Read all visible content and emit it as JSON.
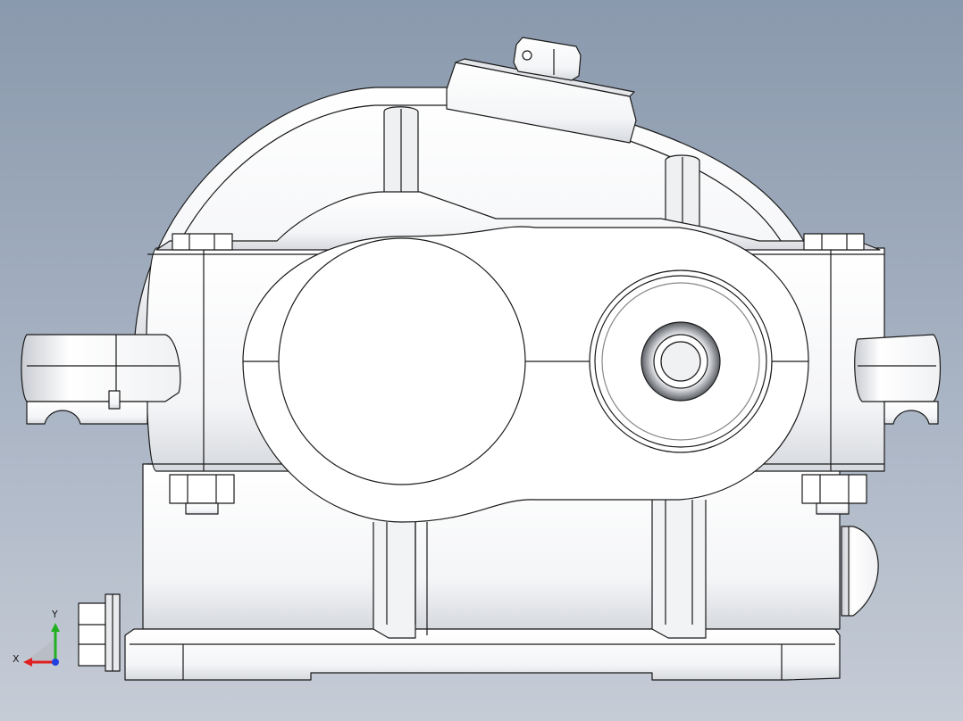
{
  "viewport": {
    "background_top": "#8a99ad",
    "background_bottom": "#c6ccd6"
  },
  "model": {
    "name": "gear-reducer-housing",
    "view": "front",
    "edge_color": "#1a1a1a",
    "face_color": "#ffffff",
    "shade_color": "#d8dbe0"
  },
  "triad": {
    "x_label": "X",
    "y_label": "Y",
    "x_color": "#e02020",
    "y_color": "#20b020",
    "z_color": "#2040e0"
  }
}
